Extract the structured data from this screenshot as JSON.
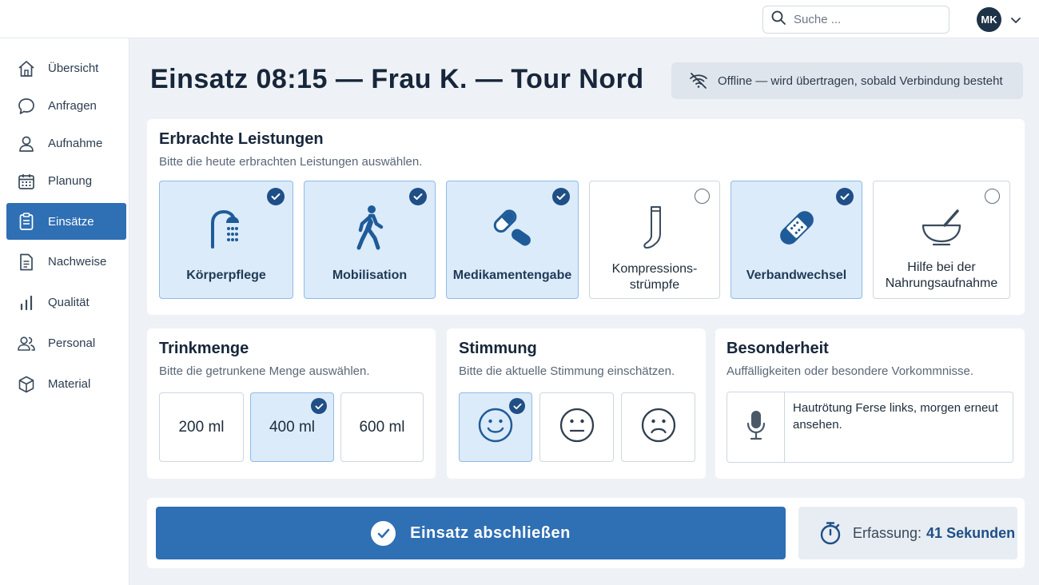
{
  "header": {
    "search_placeholder": "Suche ...",
    "avatar_initials": "MK"
  },
  "sidebar": {
    "items": [
      {
        "label": "Übersicht",
        "icon": "home-icon"
      },
      {
        "label": "Anfragen",
        "icon": "chat-icon"
      },
      {
        "label": "Aufnahme",
        "icon": "person-icon"
      },
      {
        "label": "Planung",
        "icon": "calendar-icon"
      },
      {
        "label": "Einsätze",
        "icon": "clipboard-icon",
        "active": true
      },
      {
        "label": "Nachweise",
        "icon": "document-icon"
      },
      {
        "label": "Qualität",
        "icon": "bar-chart-icon"
      },
      {
        "label": "Personal",
        "icon": "people-icon"
      },
      {
        "label": "Material",
        "icon": "box-icon"
      }
    ]
  },
  "main": {
    "title": "Einsatz 08:15 — Frau K. — Tour Nord",
    "offline_status": "Offline — wird übertragen, sobald Verbindung besteht"
  },
  "services": {
    "title": "Erbrachte Leistungen",
    "subtitle": "Bitte die heute erbrachten Leistungen auswählen.",
    "items": [
      {
        "label": "Körperpflege",
        "icon": "shower-icon",
        "selected": true
      },
      {
        "label": "Mobilisation",
        "icon": "walking-icon",
        "selected": true
      },
      {
        "label": "Medikamentengabe",
        "icon": "pill-icon",
        "selected": true
      },
      {
        "label": "Kompressions-\nstrümpfe",
        "icon": "stocking-icon",
        "selected": false
      },
      {
        "label": "Verbandwechsel",
        "icon": "bandage-icon",
        "selected": true
      },
      {
        "label": "Hilfe bei der\nNahrungsaufnahme",
        "icon": "bowl-icon",
        "selected": false
      }
    ]
  },
  "drink": {
    "title": "Trinkmenge",
    "subtitle": "Bitte die getrunkene Menge auswählen.",
    "options": [
      {
        "label": "200 ml",
        "selected": false
      },
      {
        "label": "400 ml",
        "selected": true
      },
      {
        "label": "600 ml",
        "selected": false
      }
    ]
  },
  "mood": {
    "title": "Stimmung",
    "subtitle": "Bitte die aktuelle Stimmung einschätzen.",
    "options": [
      {
        "icon": "happy-face-icon",
        "selected": true
      },
      {
        "icon": "neutral-face-icon",
        "selected": false
      },
      {
        "icon": "sad-face-icon",
        "selected": false
      }
    ]
  },
  "special": {
    "title": "Besonderheit",
    "subtitle": "Auffälligkeiten oder besondere Vorkommnisse.",
    "note": "Hautrötung Ferse links, morgen erneut ansehen."
  },
  "footer": {
    "finish_label": "Einsatz abschließen",
    "timer_label": "Erfassung:",
    "timer_value": "41 Sekunden"
  },
  "colors": {
    "primary": "#2f6fb4",
    "selected_bg": "#dcebf9",
    "check": "#1f4f86"
  }
}
